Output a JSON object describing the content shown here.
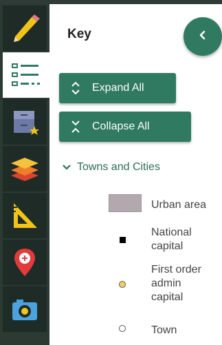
{
  "rail": {
    "items": [
      {
        "icon": "pencil-icon"
      },
      {
        "icon": "legend-list-icon"
      },
      {
        "icon": "saved-items-icon"
      },
      {
        "icon": "layers-icon"
      },
      {
        "icon": "measure-ruler-icon"
      },
      {
        "icon": "location-pin-icon"
      },
      {
        "icon": "camera-icon"
      }
    ]
  },
  "panel": {
    "title": "Key",
    "expand_all": "Expand All",
    "collapse_all": "Collapse All",
    "section_label": "Towns and Cities",
    "legend": {
      "urban_area": "Urban area",
      "national_capital_line1": "National",
      "national_capital_line2": "capital",
      "first_order_line1": "First order",
      "first_order_line2": "admin",
      "first_order_line3": "capital",
      "town": "Town"
    }
  },
  "colors": {
    "rail_bg": "#2b3a33",
    "accent": "#2f7a61",
    "section_text": "#2a6e57",
    "urban_swatch": "#b3a8ad",
    "admin_capital_dot": "#f2d25f"
  }
}
